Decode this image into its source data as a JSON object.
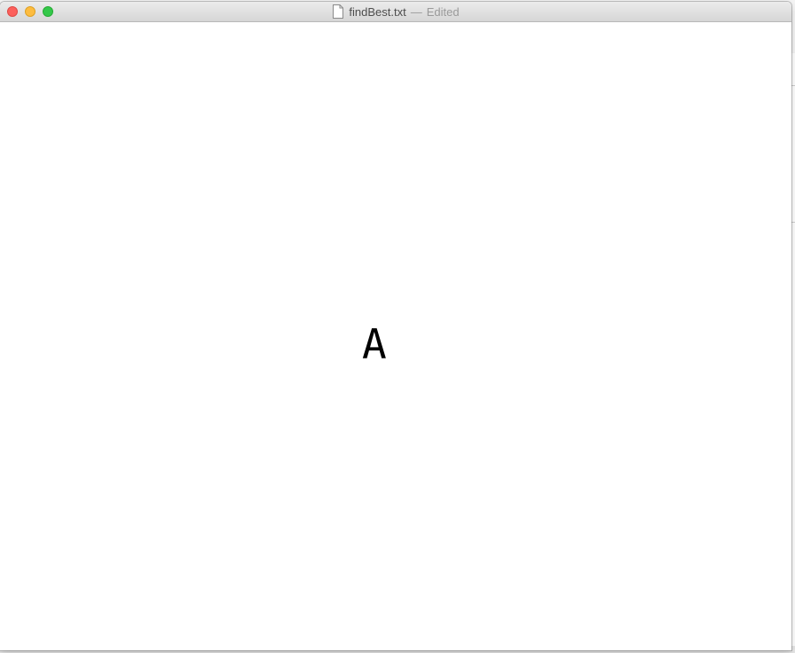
{
  "window": {
    "filename": "findBest.txt",
    "separator": "—",
    "status": "Edited"
  },
  "titlebar_icons": {
    "close": "close-icon",
    "minimize": "minimize-icon",
    "zoom": "zoom-icon",
    "document": "document-icon"
  },
  "colors": {
    "close": "#fc605c",
    "minimize": "#fdbc40",
    "zoom": "#34c84a"
  },
  "editor": {
    "text": "A"
  }
}
